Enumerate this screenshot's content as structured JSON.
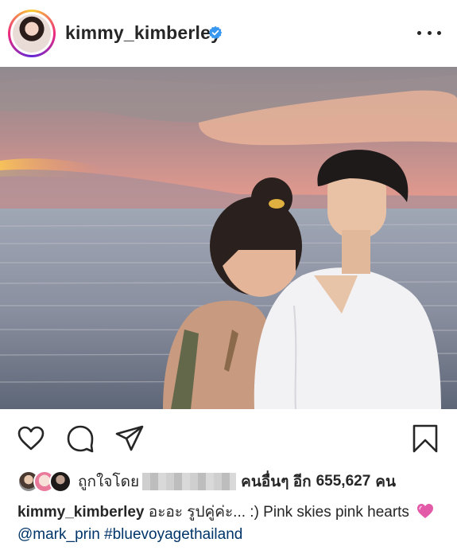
{
  "post": {
    "username": "kimmy_kimberley",
    "verified": true
  },
  "icons": {
    "verified": "verified-badge-icon",
    "more": "more-options-icon",
    "like": "heart-outline-icon",
    "comment": "comment-icon",
    "share": "paper-plane-icon",
    "save": "bookmark-icon"
  },
  "likes": {
    "prefix": "ถูกใจโดย",
    "suffix_text": "คนอื่นๆ อีก",
    "count": "655,627",
    "unit": "คน"
  },
  "caption": {
    "username": "kimmy_kimberley",
    "text": " อะอะ รูปคู่ค่ะ... :) Pink skies pink hearts",
    "emoji": "pink-heart-emoji",
    "mention": "@mark_prin",
    "hashtag": "#bluevoyagethailand"
  },
  "colors": {
    "text": "#262626",
    "verified_blue": "#3897f0",
    "link": "#003569",
    "heart_pink": "#e35aa8"
  }
}
